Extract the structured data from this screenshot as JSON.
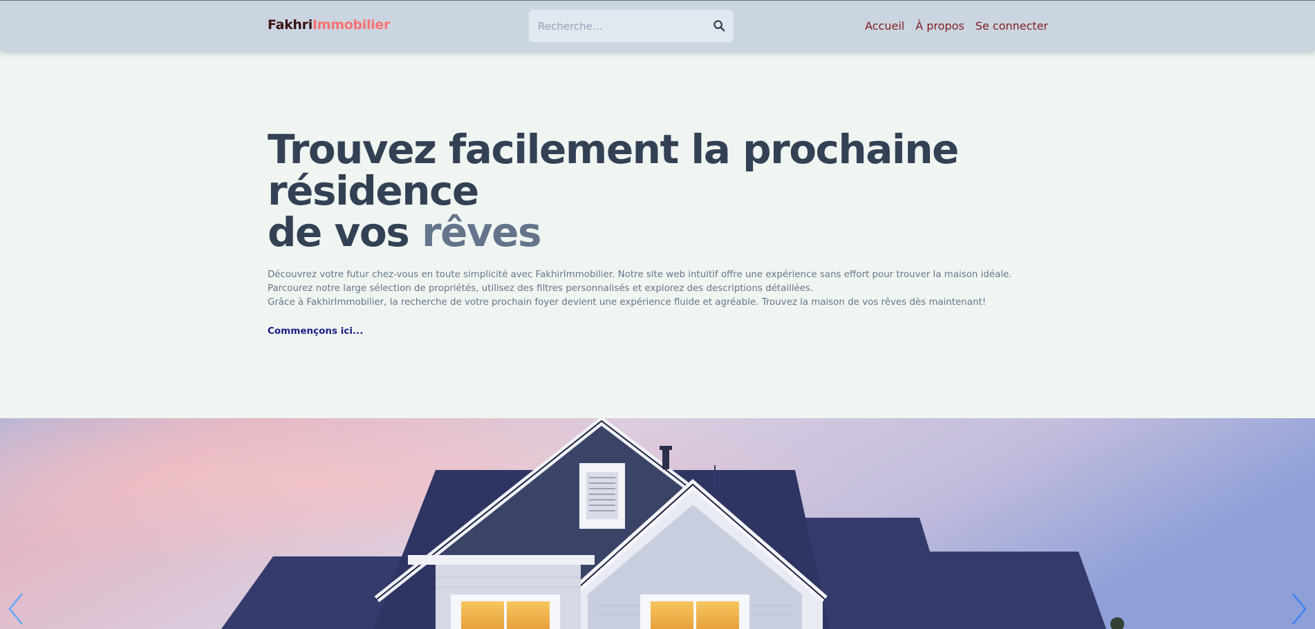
{
  "brand": {
    "name_part1": "Fakhri",
    "name_part2": "Immobilier"
  },
  "search": {
    "placeholder": "Recherche...",
    "icon": "search-icon"
  },
  "nav": {
    "home": "Accueil",
    "about": "À propos",
    "login": "Se connecter"
  },
  "hero": {
    "title_line1": "Trouvez facilement la prochaine",
    "title_line2": "résidence",
    "title_line3_prefix": "de vos",
    "title_line3_accent": "rêves",
    "paragraph1": "Découvrez votre futur chez-vous en toute simplicité avec FakhirImmobilier. Notre site web intuitif offre une expérience sans effort pour trouver la maison idéale. Parcourez notre large sélection de propriétés, utilisez des filtres personnalisés et explorez des descriptions détaillées.",
    "paragraph2": "Grâce à FakhirImmobilier, la recherche de votre prochain foyer devient une expérience fluide et agréable. Trouvez la maison de vos rêves dès maintenant!",
    "cta": "Commençons ici..."
  },
  "carousel": {
    "prev_icon": "chevron-left-icon",
    "next_icon": "chevron-right-icon"
  },
  "colors": {
    "header_bg": "#cbd5e1",
    "page_bg": "#f0f5f1",
    "brand_dark": "#3b1313",
    "brand_accent": "#f87171",
    "nav_link": "#7f1d1d",
    "title": "#334155",
    "title_accent": "#64748b",
    "cta": "#1e1b8a"
  }
}
